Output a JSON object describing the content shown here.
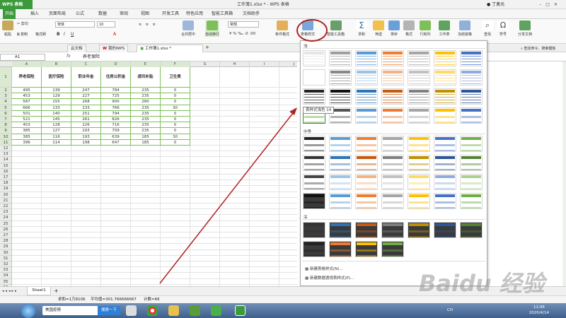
{
  "titlebar": {
    "app": "WPS 表格",
    "title": "工作簿1.xlsx * - WPS 表格",
    "user": "丁奥光"
  },
  "menubar": {
    "items": [
      "开始",
      "插入",
      "页面布局",
      "公式",
      "数据",
      "审阅",
      "视图",
      "开发工具",
      "特色应用",
      "智能工具箱",
      "文档助手"
    ],
    "active": 0
  },
  "ribbon": {
    "paste": "粘贴",
    "cut": "剪切",
    "copy": "复制",
    "format_painter": "格式刷",
    "font": "宋体",
    "size": "10",
    "merge": "合并居中",
    "wrap": "自动换行",
    "number_format": "常规",
    "cond_format": "条件格式",
    "table_style": "表格样式",
    "smart_toolbox": "智能工具箱",
    "sum": "求和",
    "filter": "筛选",
    "sort": "排序",
    "format": "格式",
    "rowcol": "行和列",
    "sheet": "工作表",
    "freeze": "冻结窗格",
    "find": "查找",
    "symbol": "符号",
    "share": "分享文档"
  },
  "tabs": [
    "云文档",
    "我的WPS",
    "工作簿1.xlsx *"
  ],
  "formula": {
    "cell": "A1",
    "fx": "fx",
    "content": "养老保险"
  },
  "search_hint": "查找命令、搜索模板",
  "columns": [
    "A",
    "B",
    "C",
    "D",
    "E",
    "F",
    "G",
    "H",
    "I",
    "J",
    "K"
  ],
  "rows": [
    "1",
    "2",
    "3",
    "4",
    "5",
    "6",
    "7",
    "8",
    "9",
    "10",
    "11",
    "12",
    "13",
    "14",
    "15",
    "16",
    "17",
    "18",
    "19",
    "20",
    "21",
    "22",
    "23",
    "24",
    "25",
    "26",
    "27",
    "28",
    "29",
    "30",
    "31",
    "32",
    "33",
    "34",
    "35",
    "36",
    "37",
    "38"
  ],
  "table": {
    "headers": [
      "养老保险",
      "医疗保险",
      "职业年金",
      "住房公积金",
      "通讯补贴",
      "卫生费"
    ],
    "data": [
      [
        "495",
        "139",
        "247",
        "784",
        "235",
        "0"
      ],
      [
        "453",
        "129",
        "227",
        "725",
        "235",
        "0"
      ],
      [
        "587",
        "155",
        "268",
        "900",
        "280",
        "0"
      ],
      [
        "666",
        "133",
        "233",
        "766",
        "235",
        "30"
      ],
      [
        "501",
        "140",
        "251",
        "794",
        "235",
        "0"
      ],
      [
        "521",
        "145",
        "261",
        "826",
        "235",
        "0"
      ],
      [
        "453",
        "128",
        "226",
        "716",
        "235",
        "0"
      ],
      [
        "385",
        "127",
        "193",
        "709",
        "235",
        "0"
      ],
      [
        "385",
        "116",
        "193",
        "639",
        "185",
        "30"
      ],
      [
        "396",
        "114",
        "198",
        "647",
        "185",
        "0"
      ]
    ]
  },
  "dropdown": {
    "light": "浅",
    "medium": "中等",
    "dark": "深",
    "tooltip": "表样式浅色 14",
    "new_table_style": "新建表格样式(N)...",
    "new_pivot_style": "新建数据透视表样式(P)...",
    "light_palettes": [
      "#ffffff",
      "#9e9e9e",
      "#5b9bd5",
      "#ed7d31",
      "#a5a5a5",
      "#ffc000",
      "#4472c4"
    ],
    "light_rows": [
      [
        "#ffffff",
        "#888888",
        "#9cc3e6",
        "#f4b183",
        "#c0c0c0",
        "#ffd966",
        "#8faadc"
      ],
      [
        "#222222",
        "#111111",
        "#2e75b6",
        "#c55a11",
        "#7f7f7f",
        "#bf9000",
        "#2f5597"
      ],
      [
        "#70ad47",
        "#555555",
        "#5b9bd5",
        "#ed7d31",
        "#a5a5a5",
        "#ffc000",
        "#4472c4"
      ]
    ],
    "medium_rows": [
      [
        "#222222",
        "#5b9bd5",
        "#ed7d31",
        "#a5a5a5",
        "#ffc000",
        "#4472c4",
        "#70ad47"
      ],
      [
        "#333333",
        "#2e75b6",
        "#c55a11",
        "#7f7f7f",
        "#bf9000",
        "#2f5597",
        "#548235"
      ],
      [
        "#444444",
        "#9cc3e6",
        "#f4b183",
        "#c0c0c0",
        "#ffd966",
        "#8faadc",
        "#a9d18e"
      ],
      [
        "#111111",
        "#5b9bd5",
        "#ed7d31",
        "#a5a5a5",
        "#ffc000",
        "#4472c4",
        "#70ad47"
      ]
    ],
    "dark_rows": [
      [
        "#333333",
        "#2e75b6",
        "#c55a11",
        "#7f7f7f",
        "#bf9000",
        "#2f5597",
        "#548235"
      ],
      [
        "#222222",
        "#ed7d31",
        "#ffc000",
        "#70ad47"
      ]
    ]
  },
  "sheet": "Sheet1",
  "status": {
    "sum": "求和=1万8106",
    "avg": "平均值=301.766666667",
    "count": "计数=66"
  },
  "taskbar": {
    "search": "搜索一下",
    "news": "美国疫情",
    "time": "11:06",
    "date": "2020/4/14",
    "lang": "CH"
  },
  "watermark": "Baidu 经验",
  "colors": {
    "green": "#3c9a3c",
    "tablebord": "#7fbf5a",
    "annotation": "#b22222"
  }
}
